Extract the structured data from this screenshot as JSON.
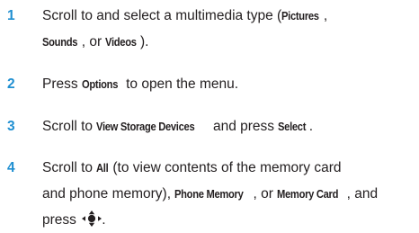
{
  "steps": [
    {
      "number": "1",
      "line1_pre": "Scroll to and select a multimedia type (",
      "line1_kw1": "Pictures",
      "line1_post": ",",
      "line2_kw1": "Sounds",
      "line2_mid": ", or ",
      "line2_kw2": "Videos",
      "line2_post": ")."
    },
    {
      "number": "2",
      "pre": "Press ",
      "kw": "Options",
      "post": " to open the menu."
    },
    {
      "number": "3",
      "pre": "Scroll to ",
      "kw1": "View Storage Devices",
      "mid": " and press ",
      "kw2": "Select",
      "post": "."
    },
    {
      "number": "4",
      "line1_pre": "Scroll to ",
      "line1_kw": "All",
      "line1_post": " (to view contents of the memory card",
      "line2_pre": "and phone memory), ",
      "line2_kw1": "Phone Memory",
      "line2_mid": ", or ",
      "line2_kw2": "Memory Card",
      "line2_post": ", and",
      "line3_pre": "press ",
      "line3_post": ".",
      "icon": "nav-key-center-select-icon"
    }
  ]
}
